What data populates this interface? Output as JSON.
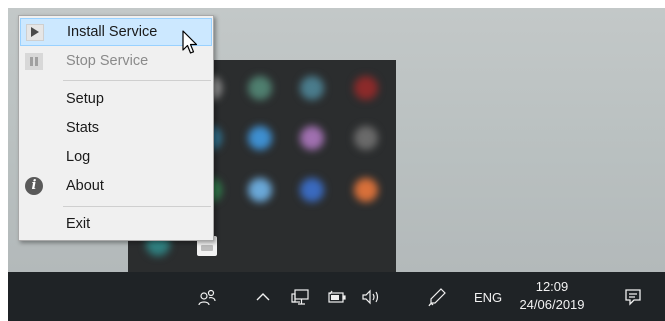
{
  "context_menu": {
    "items": [
      {
        "label": "Install Service",
        "icon": "play-icon",
        "state": "highlighted"
      },
      {
        "label": "Stop Service",
        "icon": "pause-icon",
        "state": "disabled"
      },
      {
        "label": "Setup"
      },
      {
        "label": "Stats"
      },
      {
        "label": "Log"
      },
      {
        "label": "About",
        "icon": "info-icon"
      },
      {
        "label": "Exit"
      }
    ]
  },
  "taskbar": {
    "language": "ENG",
    "time": "12:09",
    "date": "24/06/2019",
    "icons": [
      "people-icon",
      "show-hidden-icons-chevron",
      "network-icon",
      "battery-icon",
      "volume-icon",
      "pen-icon",
      "action-center-icon"
    ]
  },
  "colors": {
    "menu_highlight": "#cce8ff",
    "menu_highlight_border": "#99d1ff",
    "taskbar": "#1f2326"
  }
}
